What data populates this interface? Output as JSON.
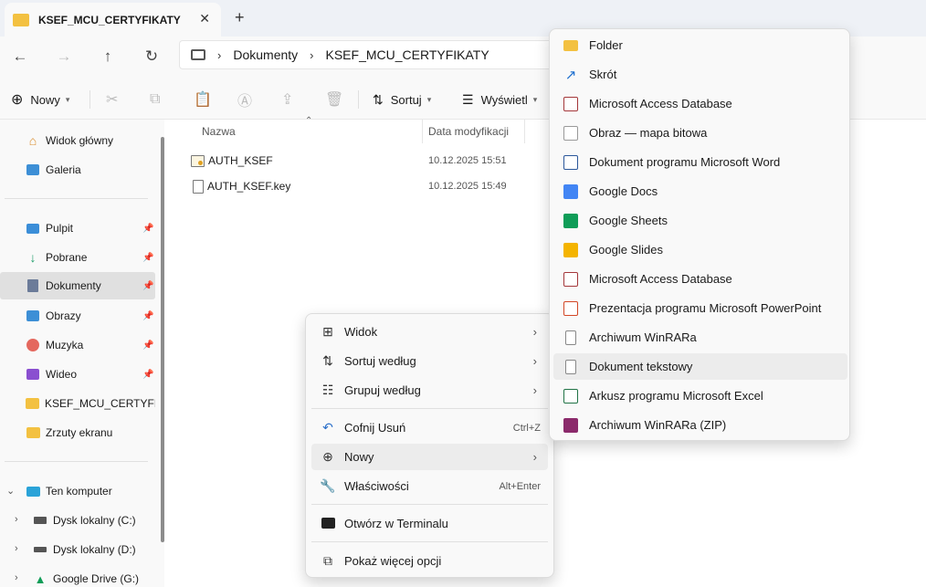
{
  "tab": {
    "title": "KSEF_MCU_CERTYFIKATY",
    "close": "✕",
    "new_tab": "+"
  },
  "address": {
    "crumbs": [
      "Dokumenty",
      "KSEF_MCU_CERTYFIKATY"
    ],
    "separator": "›"
  },
  "toolbar": {
    "new_label": "Nowy",
    "sort_label": "Sortuj",
    "view_label": "Wyświetl"
  },
  "sidebar": {
    "home": "Widok główny",
    "gallery": "Galeria",
    "quick": [
      {
        "label": "Pulpit",
        "icon": "desktop-icon",
        "color": "#3b8ed8"
      },
      {
        "label": "Pobrane",
        "icon": "download-icon",
        "color": "#1f9e6a"
      },
      {
        "label": "Dokumenty",
        "icon": "documents-icon",
        "color": "#6b7b99"
      },
      {
        "label": "Obrazy",
        "icon": "pictures-icon",
        "color": "#3d8fd6"
      },
      {
        "label": "Muzyka",
        "icon": "music-icon",
        "color": "#e4685e"
      },
      {
        "label": "Wideo",
        "icon": "video-icon",
        "color": "#8a4fd0"
      }
    ],
    "folders": [
      "KSEF_MCU_CERTYFIKATY",
      "Zrzuty ekranu"
    ],
    "this_pc": "Ten komputer",
    "drives": [
      "Dysk lokalny (C:)",
      "Dysk lokalny (D:)",
      "Google Drive (G:)"
    ]
  },
  "files": {
    "columns": {
      "name": "Nazwa",
      "modified": "Data modyfikacji"
    },
    "rows": [
      {
        "name": "AUTH_KSEF",
        "date": "10.12.2025 15:51",
        "icon": "certificate-icon"
      },
      {
        "name": "AUTH_KSEF.key",
        "date": "10.12.2025 15:49",
        "icon": "file-icon"
      }
    ]
  },
  "context_menu": [
    {
      "label": "Widok",
      "icon": "view-icon",
      "arrow": "›"
    },
    {
      "label": "Sortuj według",
      "icon": "sort-icon",
      "arrow": "›"
    },
    {
      "label": "Grupuj według",
      "icon": "group-icon",
      "arrow": "›"
    },
    {
      "label": "Cofnij Usuń",
      "icon": "undo-icon",
      "shortcut": "Ctrl+Z"
    },
    {
      "label": "Nowy",
      "icon": "new-icon",
      "arrow": "›"
    },
    {
      "label": "Właściwości",
      "icon": "properties-icon",
      "shortcut": "Alt+Enter"
    },
    {
      "label": "Otwórz w Terminalu",
      "icon": "terminal-icon"
    },
    {
      "label": "Pokaż więcej opcji",
      "icon": "more-options-icon"
    }
  ],
  "submenu": [
    {
      "label": "Folder",
      "icon": "folder-icon",
      "color": "#f3c141"
    },
    {
      "label": "Skrót",
      "icon": "shortcut-icon",
      "color": "#1e6fcf"
    },
    {
      "label": "Microsoft Access Database",
      "icon": "access-icon",
      "color": "#a4373a"
    },
    {
      "label": "Obraz — mapa bitowa",
      "icon": "bitmap-icon",
      "color": "#4a90d9"
    },
    {
      "label": "Dokument programu Microsoft Word",
      "icon": "word-icon",
      "color": "#2b579a"
    },
    {
      "label": "Google Docs",
      "icon": "google-docs-icon",
      "color": "#4285f4"
    },
    {
      "label": "Google Sheets",
      "icon": "google-sheets-icon",
      "color": "#0f9d58"
    },
    {
      "label": "Google Slides",
      "icon": "google-slides-icon",
      "color": "#f4b400"
    },
    {
      "label": "Microsoft Access Database",
      "icon": "access-icon",
      "color": "#a4373a"
    },
    {
      "label": "Prezentacja programu Microsoft PowerPoint",
      "icon": "powerpoint-icon",
      "color": "#d24726"
    },
    {
      "label": "Archiwum WinRARa",
      "icon": "blank-file-icon",
      "color": "#ffffff"
    },
    {
      "label": "Dokument tekstowy",
      "icon": "text-file-icon",
      "color": "#ffffff"
    },
    {
      "label": "Arkusz programu Microsoft Excel",
      "icon": "excel-icon",
      "color": "#217346"
    },
    {
      "label": "Archiwum WinRARa (ZIP)",
      "icon": "winrar-icon",
      "color": "#8b2a6b"
    }
  ]
}
